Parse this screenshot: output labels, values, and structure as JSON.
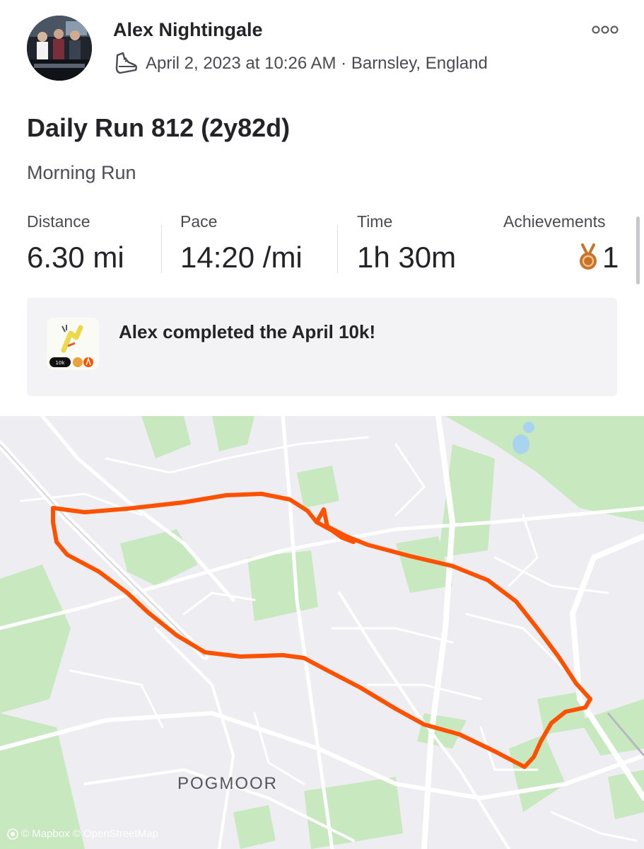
{
  "header": {
    "athlete_name": "Alex Nightingale",
    "avatar_icon": "group-photo-avatar",
    "activity_type_icon": "shoe-icon",
    "date_location": "April 2, 2023 at 10:26 AM · Barnsley, England",
    "more_icon": "more-options-icon"
  },
  "activity": {
    "title": "Daily Run 812 (2y82d)",
    "description": "Morning Run"
  },
  "stats": [
    {
      "label": "Distance",
      "value": "6.30 mi"
    },
    {
      "label": "Pace",
      "value": "14:20 /mi"
    },
    {
      "label": "Time",
      "value": "1h 30m"
    }
  ],
  "achievements": {
    "label": "Achievements",
    "count": "1",
    "icon": "bronze-medal-icon",
    "medal_color": "#c8732a"
  },
  "challenge": {
    "text": "Alex completed the April 10k!",
    "badge_caption": "10k",
    "badge_icon": "challenge-badge-icon"
  },
  "map": {
    "place_label": "POGMOOR",
    "attribution": "© Mapbox © OpenStreetMap",
    "route_color": "#fc5200",
    "park_color": "#c8e8c0",
    "land_color": "#eeeef2",
    "road_color": "#ffffff"
  }
}
